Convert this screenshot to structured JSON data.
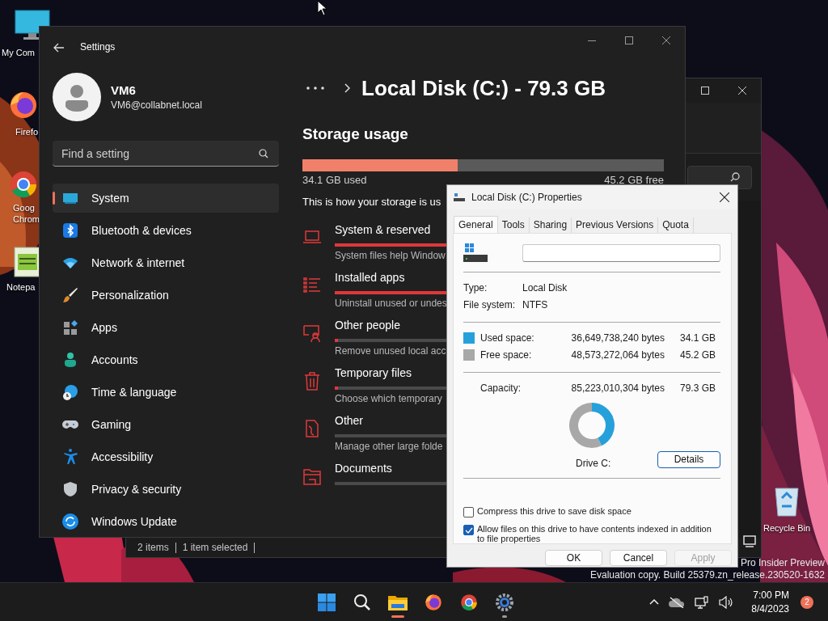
{
  "desktop_icons": [
    {
      "kind": "computer",
      "label": "My Com"
    },
    {
      "kind": "firefox",
      "label": "Firefo"
    },
    {
      "kind": "chrome",
      "label": "Goog Chrom"
    },
    {
      "kind": "notepad",
      "label": "Notepa"
    },
    {
      "kind": "recycle",
      "label": "Recycle Bin"
    }
  ],
  "desktop_notice": [
    "Pro Insider Preview",
    "Evaluation copy. Build 25379.zn_release.230520-1632"
  ],
  "explorer": {
    "status_bar": [
      "2 items",
      "1 item selected"
    ]
  },
  "settings": {
    "title": "Settings",
    "user": {
      "name": "VM6",
      "email": "VM6@collabnet.local"
    },
    "search": {
      "placeholder": "Find a setting"
    },
    "nav": [
      {
        "kind": "system",
        "label": "System",
        "selected": true
      },
      {
        "kind": "bluetooth",
        "label": "Bluetooth & devices",
        "selected": false
      },
      {
        "kind": "network",
        "label": "Network & internet",
        "selected": false
      },
      {
        "kind": "personalization",
        "label": "Personalization",
        "selected": false
      },
      {
        "kind": "apps",
        "label": "Apps",
        "selected": false
      },
      {
        "kind": "accounts",
        "label": "Accounts",
        "selected": false
      },
      {
        "kind": "time",
        "label": "Time & language",
        "selected": false
      },
      {
        "kind": "gaming",
        "label": "Gaming",
        "selected": false
      },
      {
        "kind": "accessibility",
        "label": "Accessibility",
        "selected": false
      },
      {
        "kind": "privacy",
        "label": "Privacy & security",
        "selected": false
      },
      {
        "kind": "update",
        "label": "Windows Update",
        "selected": false
      }
    ],
    "breadcrumb": {
      "current": "Local Disk (C:) - 79.3 GB"
    },
    "heading": "Storage usage",
    "usage": {
      "level": 0.43,
      "used": "34.1 GB used",
      "free": "45.2 GB free"
    },
    "intro": "This is how your storage is us",
    "categories": [
      {
        "kind": "system",
        "title": "System & reserved",
        "level": 0.6,
        "description": "System files help Window"
      },
      {
        "kind": "apps",
        "title": "Installed apps",
        "level": 0.55,
        "description": "Uninstall unused or undes"
      },
      {
        "kind": "people",
        "title": "Other people",
        "level": 0.01,
        "description": "Remove unused local acc"
      },
      {
        "kind": "temp",
        "title": "Temporary files",
        "level": 0.01,
        "description": "Choose which temporary"
      },
      {
        "kind": "other",
        "title": "Other",
        "description": "Manage other large folde"
      },
      {
        "kind": "documents",
        "title": "Documents"
      }
    ]
  },
  "properties": {
    "title": "Local Disk (C:) Properties",
    "tabs": [
      {
        "label": "General",
        "selected": true
      },
      {
        "label": "Tools",
        "selected": false
      },
      {
        "label": "Sharing",
        "selected": false
      },
      {
        "label": "Previous Versions",
        "selected": false
      },
      {
        "label": "Quota",
        "selected": false
      }
    ],
    "info": [
      {
        "label": "Type:",
        "value": "Local Disk"
      },
      {
        "label": "File system:",
        "value": "NTFS"
      }
    ],
    "space": [
      {
        "label": "Used space:",
        "bytes": "36,649,738,240 bytes",
        "size": "34.1 GB",
        "color": "#26a0da"
      },
      {
        "label": "Free space:",
        "bytes": "48,573,272,064 bytes",
        "size": "45.2 GB",
        "color": "#a8a8a8"
      }
    ],
    "capacity": {
      "label": "Capacity:",
      "bytes": "85,223,010,304 bytes",
      "size": "79.3 GB"
    },
    "chart_data": {
      "type": "donut",
      "values": [
        43,
        57
      ]
    },
    "drive_label": "Drive C:",
    "details_button": "Details",
    "options": [
      {
        "label": "Compress this drive to save disk space",
        "checked": false
      },
      {
        "label": "Allow files on this drive to have contents indexed in addition to file properties",
        "checked": true
      }
    ],
    "buttons": [
      {
        "label": "OK",
        "disabled": false
      },
      {
        "label": "Cancel",
        "disabled": false
      },
      {
        "label": "Apply",
        "disabled": true
      }
    ]
  },
  "taskbar": {
    "apps": [
      {
        "kind": "start",
        "active": false,
        "running": false
      },
      {
        "kind": "search",
        "active": false,
        "running": false
      },
      {
        "kind": "folder",
        "active": true,
        "running": true
      },
      {
        "kind": "firefox",
        "active": false,
        "running": false
      },
      {
        "kind": "chrome",
        "active": false,
        "running": false
      },
      {
        "kind": "settings",
        "active": false,
        "running": true
      }
    ],
    "clock": {
      "time": "7:00 PM",
      "date": "8/4/2023"
    },
    "notification_count": "2"
  }
}
